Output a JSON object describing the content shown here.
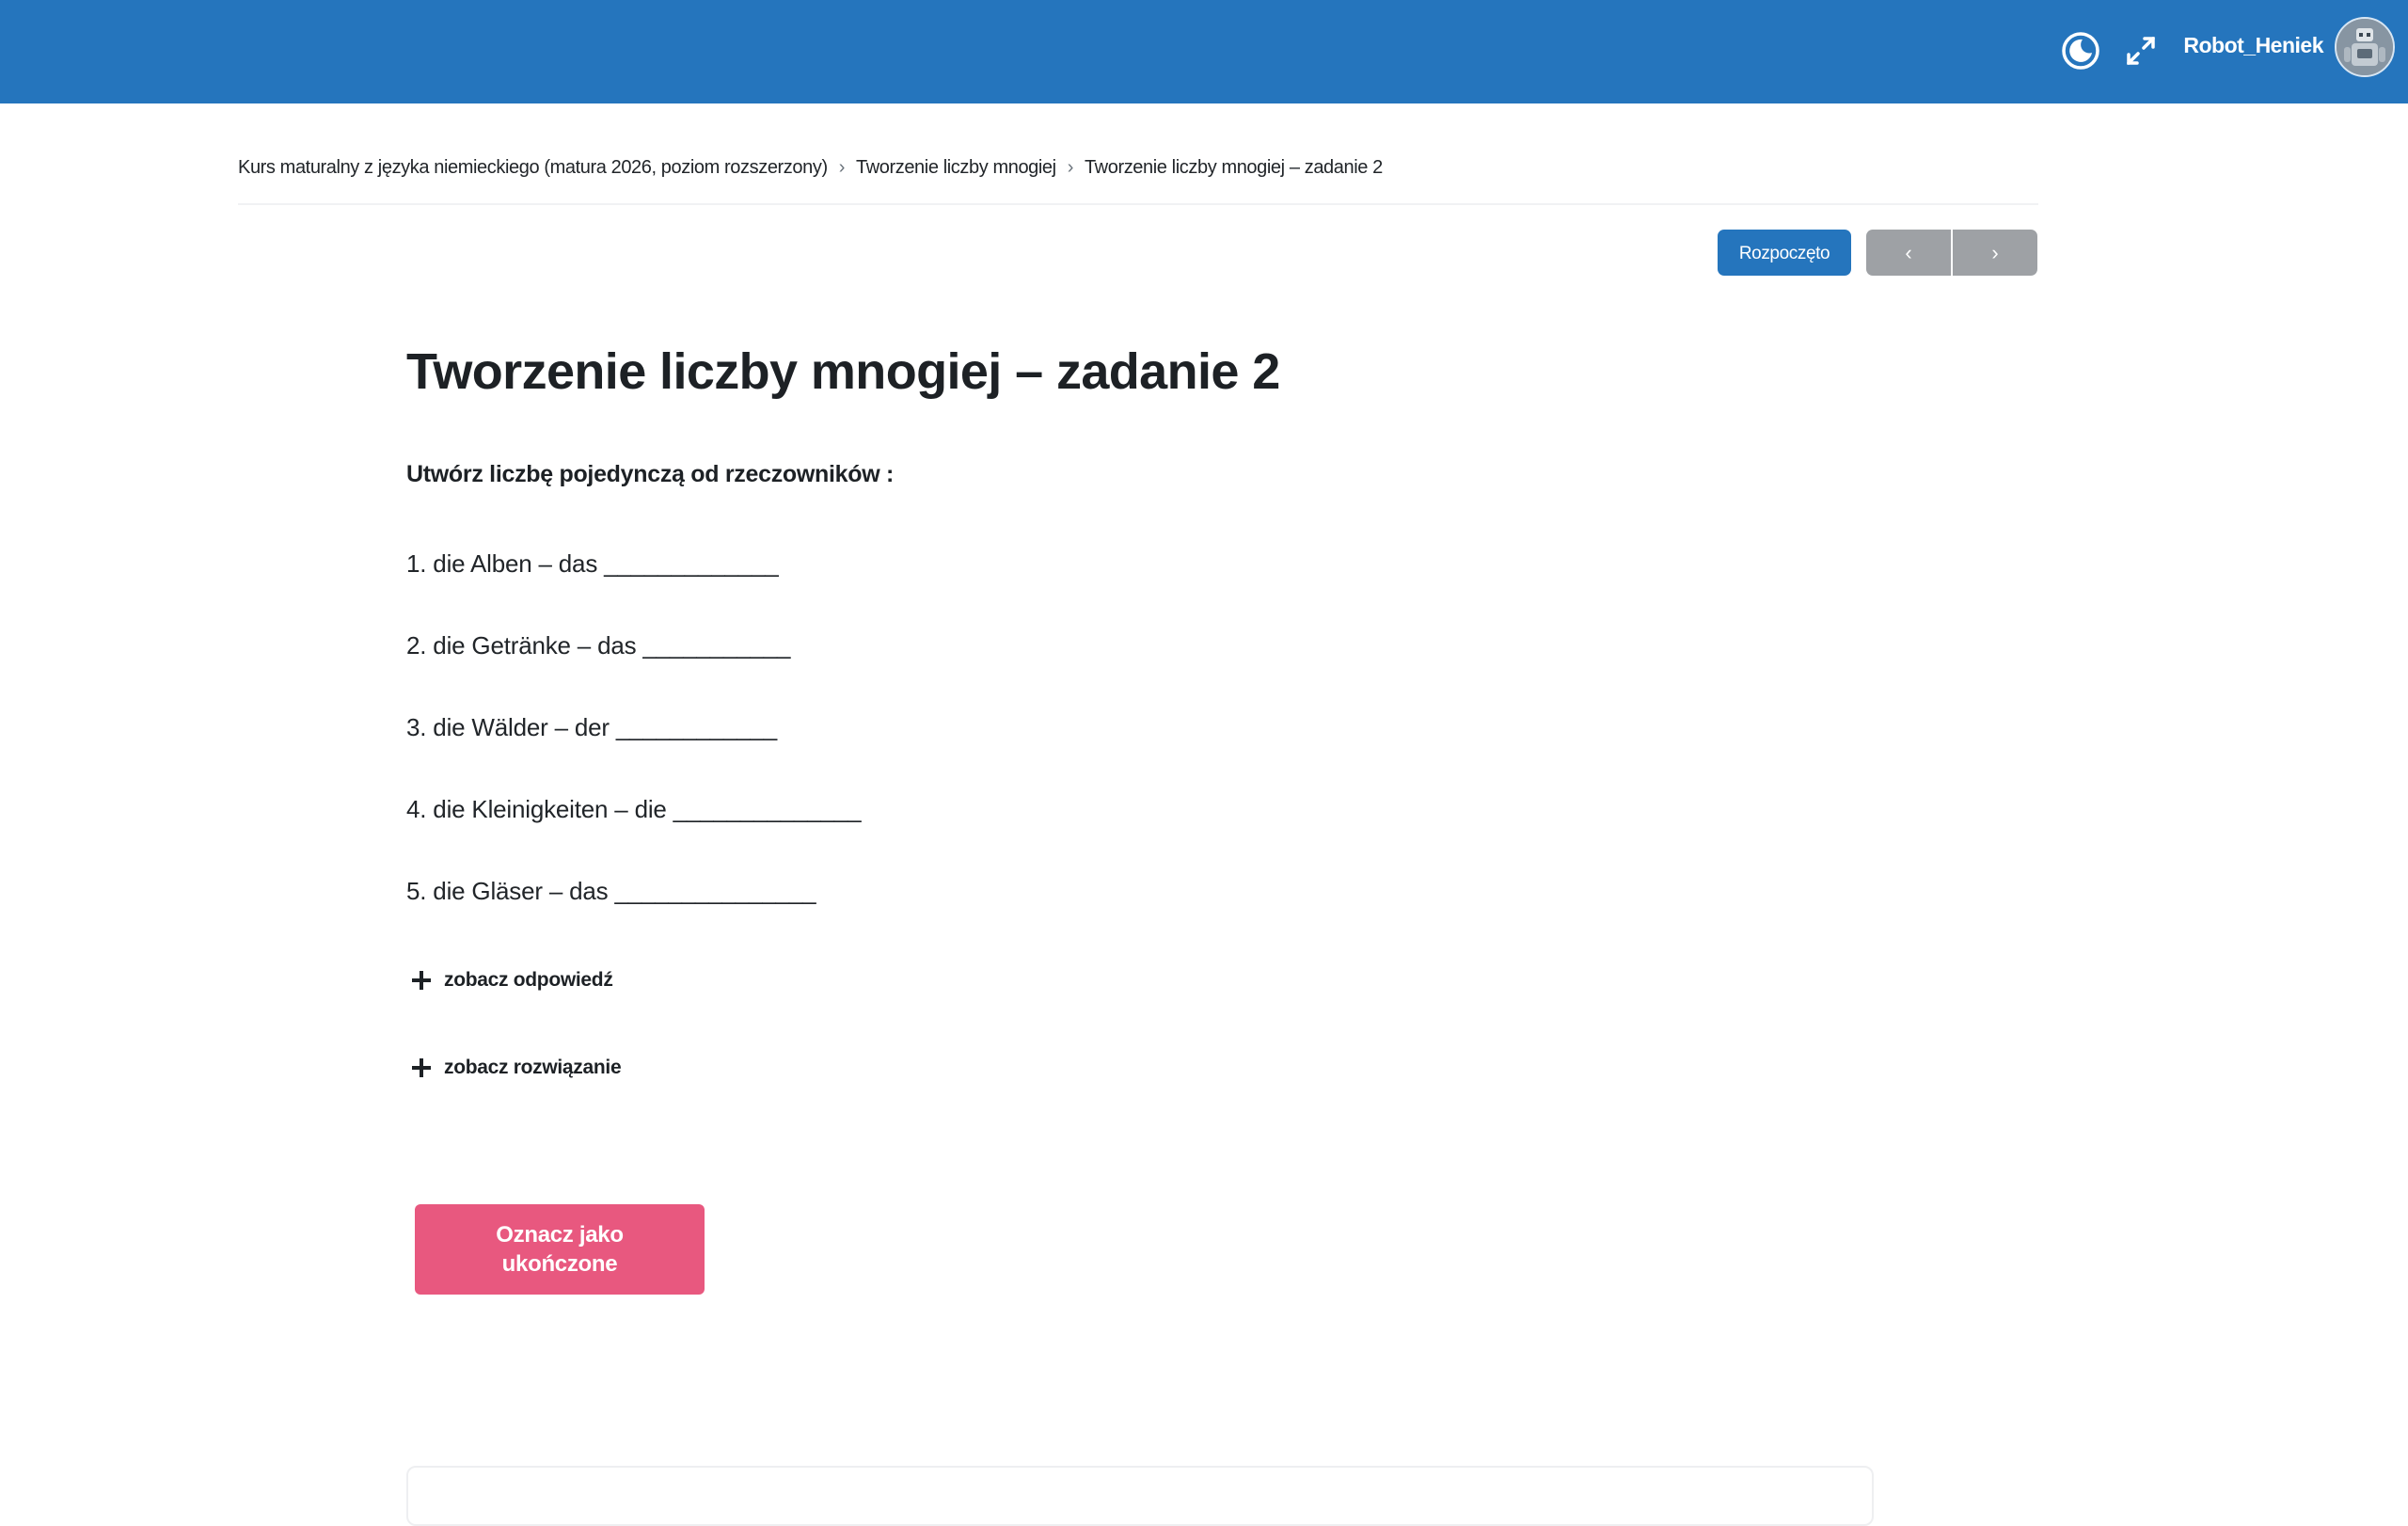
{
  "header": {
    "username": "Robot_Heniek",
    "icons": [
      "dark-mode-icon",
      "fullscreen-icon"
    ],
    "bg_color": "#2575bd"
  },
  "breadcrumb": {
    "items": [
      "Kurs maturalny z języka niemieckiego (matura 2026, poziom rozszerzony)",
      "Tworzenie liczby mnogiej",
      "Tworzenie liczby mnogiej – zadanie 2"
    ]
  },
  "actions": {
    "status_label": "Rozpoczęto",
    "prev_label": "‹",
    "next_label": "›"
  },
  "main": {
    "title": "Tworzenie liczby mnogiej – zadanie 2",
    "instruction": "Utwórz liczbę pojedynczą od rzeczowników :",
    "exercises": [
      "1. die Alben – das _____________",
      "2. die Getränke – das ___________",
      "3. die Wälder – der ____________",
      "4. die Kleinigkeiten – die ______________",
      "5. die Gläser – das _______________"
    ],
    "show_answer": "zobacz odpowiedź",
    "show_solution": "zobacz rozwiązanie",
    "complete_button": "Oznacz jako ukończone"
  },
  "colors": {
    "accent": "#2575bd",
    "complete": "#e8587f",
    "nav_buttons": "#9ea1a5"
  }
}
